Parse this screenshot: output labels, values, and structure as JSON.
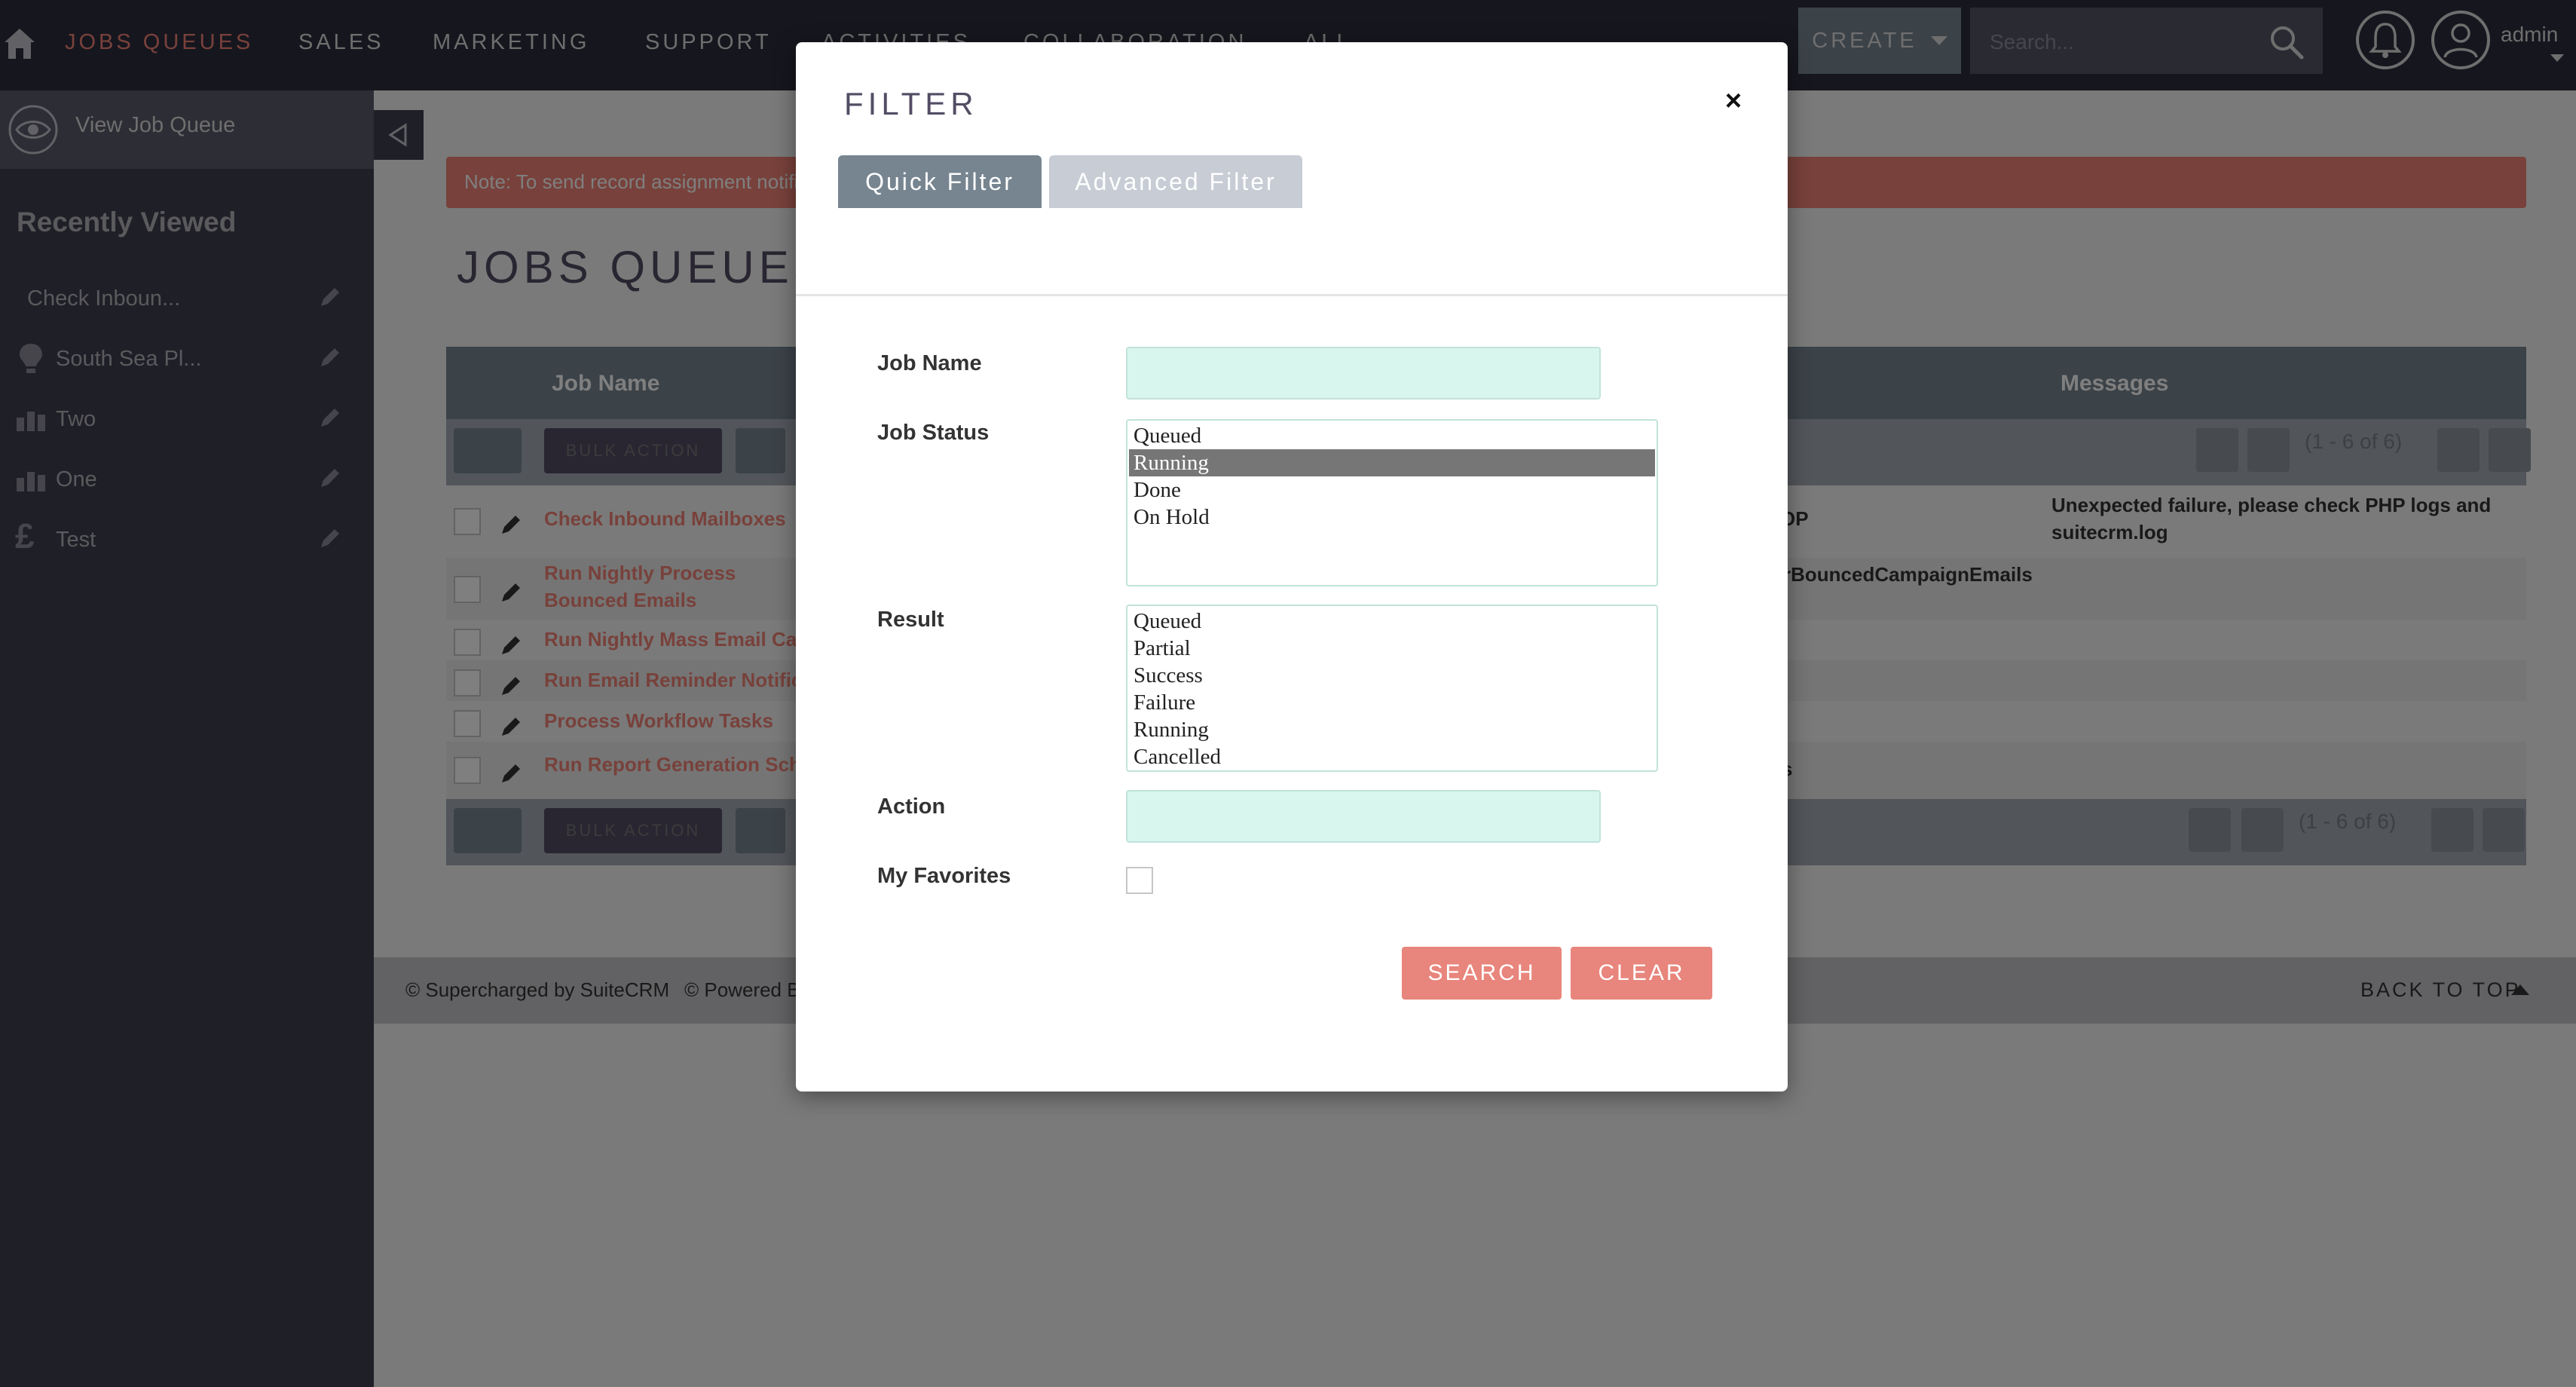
{
  "nav": {
    "items": [
      "JOBS QUEUES",
      "SALES",
      "MARKETING",
      "SUPPORT",
      "ACTIVITIES",
      "COLLABORATION",
      "ALL"
    ],
    "create_label": "CREATE",
    "search_placeholder": "Search...",
    "user_label": "admin"
  },
  "colors": {
    "accent": "#f08377",
    "nav_bg": "#2d2d3d",
    "sidebar_bg": "#3e3e4e",
    "input_bg": "#d8f5ee",
    "button": "#e8857c"
  },
  "sidebar": {
    "view_label": "View Job Queue",
    "recent_heading": "Recently Viewed",
    "recent_items": [
      {
        "label": "Check Inboun...",
        "icon": "none"
      },
      {
        "label": "South Sea Pl...",
        "icon": "lightbulb-icon"
      },
      {
        "label": "Two",
        "icon": "bar-chart-icon"
      },
      {
        "label": "One",
        "icon": "bar-chart-icon"
      },
      {
        "label": "Test",
        "icon": "pound-icon"
      }
    ]
  },
  "main": {
    "note": "Note: To send record assignment notifi",
    "title": "JOBS QUEUES",
    "columns": {
      "job_name": "Job Name",
      "messages": "Messages"
    },
    "bulk_action": "BULK ACTION",
    "pagination": "(1 - 6 of 6)",
    "rows": [
      {
        "name": "Check Inbound Mailboxes",
        "status_fragment": "OP",
        "message": "Unexpected failure, please check PHP logs and suitecrm.log"
      },
      {
        "name": "Run Nightly Process Bounced Emails",
        "status_fragment": "rBouncedCampaignEmails",
        "message": ""
      },
      {
        "name": "Run Nightly Mass Email Cam",
        "status_fragment": "",
        "message": ""
      },
      {
        "name": "Run Email Reminder Notifica",
        "status_fragment": "",
        "message": ""
      },
      {
        "name": "Process Workflow Tasks",
        "status_fragment": "",
        "message": ""
      },
      {
        "name": "Run Report Generation Sche",
        "status_fragment": "s",
        "message": ""
      }
    ]
  },
  "footer": {
    "supercharged": "© Supercharged by SuiteCRM",
    "powered": "© Powered B",
    "back_to_top": "BACK TO TOP"
  },
  "modal": {
    "title": "FILTER",
    "tabs": [
      "Quick Filter",
      "Advanced Filter"
    ],
    "labels": {
      "job_name": "Job Name",
      "job_status": "Job Status",
      "result": "Result",
      "action": "Action",
      "my_favorites": "My Favorites"
    },
    "job_status_options": [
      "Queued",
      "Running",
      "Done",
      "On Hold"
    ],
    "job_status_selected": "Running",
    "result_options": [
      "Queued",
      "Partial",
      "Success",
      "Failure",
      "Running",
      "Cancelled"
    ],
    "search_label": "SEARCH",
    "clear_label": "CLEAR"
  }
}
